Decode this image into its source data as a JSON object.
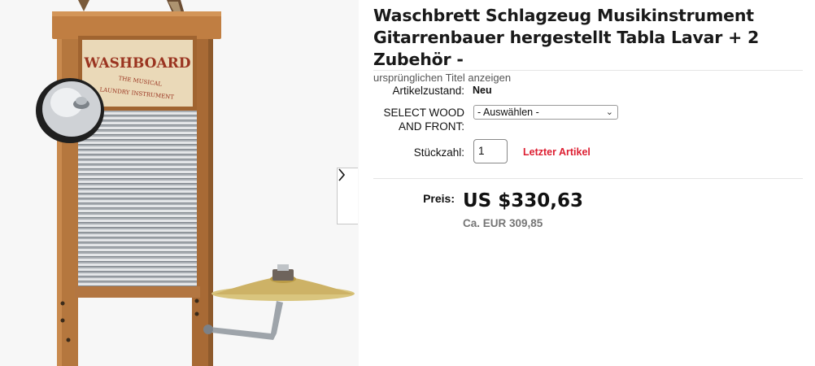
{
  "product": {
    "title_line1": "Waschbrett Schlagzeug Musikinstrument",
    "title_line2": "Gitarrenbauer hergestellt Tabla Lavar + 2 Zubehör -",
    "show_original_title": "ursprünglichen Titel anzeigen"
  },
  "image": {
    "sign_text": "WASHBOARD",
    "sign_subtext1": "THE MUSICAL",
    "sign_subtext2": "LAUNDRY INSTRUMENT",
    "next_icon": "chevron-right-icon"
  },
  "details": {
    "condition_label": "Artikelzustand:",
    "condition_value": "Neu",
    "variant_label_line1": "SELECT WOOD",
    "variant_label_line2": "AND FRONT:",
    "variant_selected": "- Auswählen -",
    "quantity_label": "Stückzahl:",
    "quantity_value": "1",
    "last_item": "Letzter Artikel"
  },
  "pricing": {
    "price_label": "Preis:",
    "price": "US $330,63",
    "approx": "Ca. EUR 309,85"
  },
  "colors": {
    "accent_red": "#dd1e31",
    "wood": "#b5773e",
    "text": "#111820"
  }
}
